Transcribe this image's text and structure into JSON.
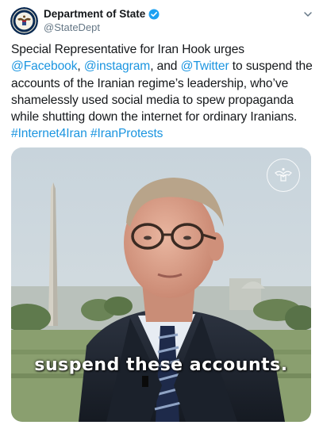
{
  "tweet": {
    "author_name": "Department of State",
    "author_handle": "@StateDept",
    "verified": true,
    "text_segments": [
      {
        "text": "Special Representative for Iran Hook urges ",
        "link": false
      },
      {
        "text": "@Facebook",
        "link": true
      },
      {
        "text": ", ",
        "link": false
      },
      {
        "text": "@instagram",
        "link": true
      },
      {
        "text": ", and ",
        "link": false
      },
      {
        "text": "@Twitter",
        "link": true
      },
      {
        "text": " to suspend the accounts of the Iranian regime’s leadership, who’ve shamelessly used social media to spew propaganda while shutting down the internet for ordinary Iranians. ",
        "link": false
      },
      {
        "text": "#Internet4Iran",
        "link": true
      },
      {
        "text": " ",
        "link": false
      },
      {
        "text": "#IranProtests",
        "link": true
      }
    ],
    "video_caption": "suspend these accounts.",
    "icons": [
      "state-seal-icon",
      "verified-badge-icon",
      "chevron-down-icon",
      "video-seal-watermark-icon"
    ],
    "colors": {
      "link": "#1b95e0",
      "text": "#14171a",
      "muted": "#657786",
      "verified": "#1da1f2"
    }
  }
}
